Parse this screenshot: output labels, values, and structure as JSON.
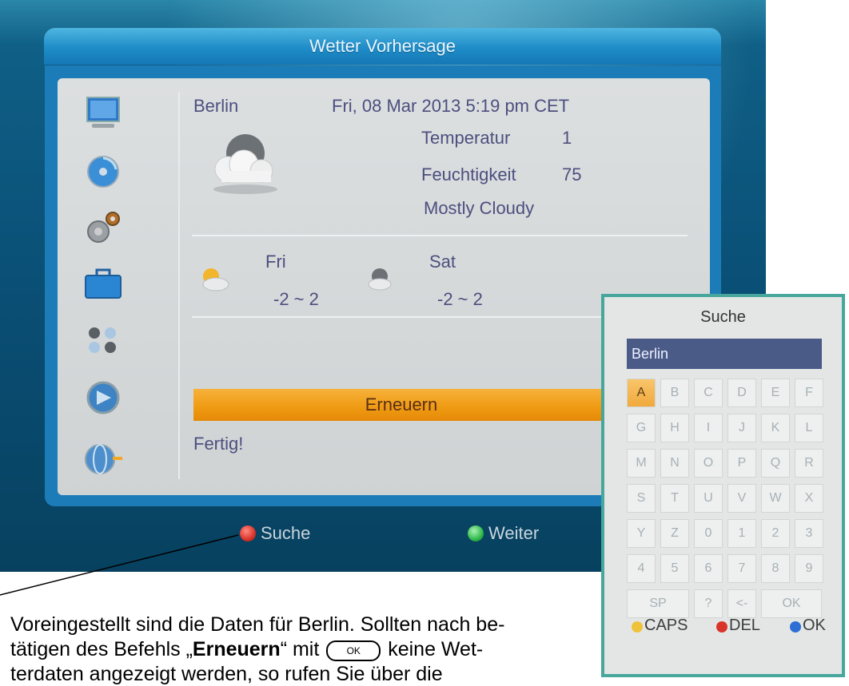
{
  "screen": {
    "title": "Wetter Vorhersage",
    "sidebar_icons": [
      "monitor-icon",
      "disc-icon",
      "settings-gears-icon",
      "toolbox-icon",
      "apps-dots-icon",
      "media-icon",
      "globe-icon"
    ],
    "weather": {
      "city": "Berlin",
      "datetime": "Fri, 08 Mar 2013 5:19 pm CET",
      "temperature_label": "Temperatur",
      "temperature_value": "1",
      "humidity_label": "Feuchtigkeit",
      "humidity_value": "75",
      "condition": "Mostly Cloudy",
      "forecast": [
        {
          "day": "Fri",
          "range": "-2 ~ 2",
          "icon": "partly-sunny-icon"
        },
        {
          "day": "Sat",
          "range": "-2 ~ 2",
          "icon": "cloudy-icon"
        }
      ]
    },
    "refresh_button": "Erneuern",
    "status": "Fertig!",
    "footer": {
      "search_label": "Suche",
      "next_label": "Weiter"
    }
  },
  "search_dialog": {
    "title": "Suche",
    "input_value": "Berlin",
    "keys": [
      [
        "A",
        "B",
        "C",
        "D",
        "E",
        "F"
      ],
      [
        "G",
        "H",
        "I",
        "J",
        "K",
        "L"
      ],
      [
        "M",
        "N",
        "O",
        "P",
        "Q",
        "R"
      ],
      [
        "S",
        "T",
        "U",
        "V",
        "W",
        "X"
      ],
      [
        "Y",
        "Z",
        "0",
        "1",
        "2",
        "3"
      ],
      [
        "4",
        "5",
        "6",
        "7",
        "8",
        "9"
      ]
    ],
    "last_row": [
      "SP",
      "?",
      "<-",
      "OK"
    ],
    "active_key": "A",
    "footer": {
      "caps": "CAPS",
      "del": "DEL",
      "ok": "OK"
    }
  },
  "caption": {
    "line1": "Voreingestellt sind die Daten für Berlin. Sollten nach be-",
    "line2_before": "tätigen des Befehls „",
    "line2_bold": "Erneuern",
    "line2_mid": "“ mit",
    "ok_key": "OK",
    "line2_after": "keine Wet-",
    "line3": "terdaten angezeigt werden, so rufen Sie über die"
  },
  "colors": {
    "accent_orange": "#ef9a12",
    "title_blue": "#1e8cc8",
    "red_key": "#d9342a",
    "green_key": "#2fb94a",
    "yellow_key": "#f0c23a",
    "blue_key": "#2e6fd6",
    "dialog_border": "#47a79c"
  }
}
